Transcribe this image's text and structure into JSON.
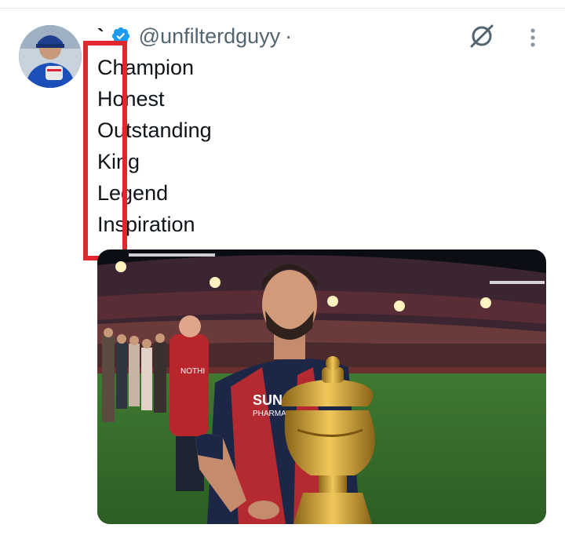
{
  "tweet": {
    "display_name": "`",
    "handle": "@unfilterdguyy",
    "separator": "·",
    "lines": [
      "Champion",
      "Honest",
      "Outstanding",
      "King",
      "Legend",
      "Inspiration"
    ],
    "verified": true,
    "grok_icon": "grok-icon",
    "more_icon": "more-vertical-icon"
  },
  "media": {
    "jersey_sponsor": "SUN",
    "jersey_sponsor_sub": "PHARMA",
    "side_jersey_text": "NOTHI"
  },
  "colors": {
    "accent": "#1d9bf0",
    "highlight": "#e0262f",
    "secondary_text": "#536471",
    "text": "#0f1419"
  }
}
